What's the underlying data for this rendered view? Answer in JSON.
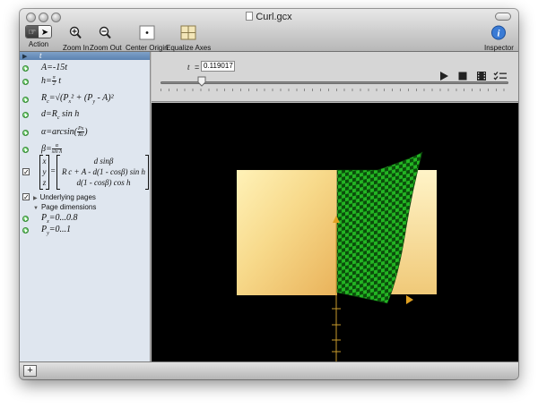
{
  "window": {
    "title": "Curl.gcx"
  },
  "toolbar": {
    "action_label": "Action",
    "zoom_in_label": "Zoom In",
    "zoom_out_label": "Zoom Out",
    "center_origin_label": "Center Origin",
    "equalize_axes_label": "Equalize Axes",
    "inspector_label": "Inspector"
  },
  "sidebar": {
    "header_var": "t",
    "eq_A_lhs": "A",
    "eq_A_rhs": "=-15t",
    "eq_h_lhs": "h",
    "eq_h_eq": "=",
    "eq_h_num": "π",
    "eq_h_den": "2",
    "eq_h_tail": " t",
    "eq_Rc_lhs": "R",
    "eq_Rc_sub": "c",
    "eq_Rc_rhs": "=√(P",
    "eq_Rc_px": "x",
    "eq_Rc_mid": "² + (P",
    "eq_Rc_py": "y",
    "eq_Rc_end": " - A)²",
    "eq_d": "d=R",
    "eq_d_sub": "c",
    "eq_d_end": " sin h",
    "eq_alpha": "α=arcsin(",
    "eq_alpha_num": "Px",
    "eq_alpha_den": "Rc",
    "eq_alpha_close": ")",
    "eq_beta": "β=",
    "eq_beta_num": "α",
    "eq_beta_den": "sin h",
    "matrix_x": "x",
    "matrix_y": "y",
    "matrix_z": "z",
    "matrix_eq": "=",
    "matrix_row1": "d sinβ",
    "matrix_row2": "R c + A - d(1 - cosβ) sin h",
    "matrix_row3": "d(1 - cosβ) cos h",
    "underlying_pages": "Underlying pages",
    "page_dimensions": "Page dimensions",
    "px_range": "=0...0.8",
    "px_lhs": "P",
    "px_sub": "x",
    "py_range": "=0...1",
    "py_lhs": "P",
    "py_sub": "y"
  },
  "controls": {
    "var_label": "t",
    "eq_sign": "=",
    "t_value": "0.119017",
    "slider_value": 0.119017
  },
  "colors": {
    "page_yellow": "#f7d98a",
    "green": "#1fa61f",
    "dark_green": "#0b4d0b",
    "accent_blue": "#3a7bd5"
  }
}
